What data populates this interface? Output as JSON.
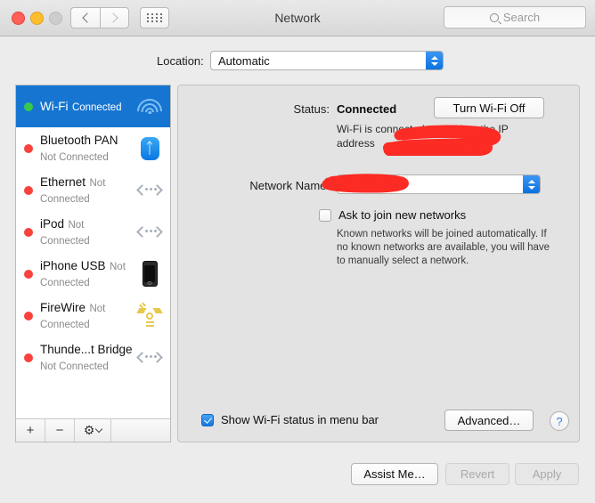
{
  "window": {
    "title": "Network",
    "traffic_lights": [
      "close",
      "minimize",
      "zoom"
    ],
    "search_placeholder": "Search",
    "nav_back": "‹",
    "nav_forward": "›"
  },
  "location": {
    "label": "Location:",
    "value": "Automatic"
  },
  "sidebar": {
    "services": [
      {
        "name": "Wi-Fi",
        "status": "Connected",
        "dot": "green",
        "icon": "wifi-icon",
        "selected": true
      },
      {
        "name": "Bluetooth PAN",
        "status": "Not Connected",
        "dot": "red",
        "icon": "bluetooth-icon",
        "selected": false
      },
      {
        "name": "Ethernet",
        "status": "Not Connected",
        "dot": "red",
        "icon": "port-icon",
        "selected": false
      },
      {
        "name": "iPod",
        "status": "Not Connected",
        "dot": "red",
        "icon": "port-icon",
        "selected": false
      },
      {
        "name": "iPhone USB",
        "status": "Not Connected",
        "dot": "red",
        "icon": "iphone-icon",
        "selected": false
      },
      {
        "name": "FireWire",
        "status": "Not Connected",
        "dot": "red",
        "icon": "firewire-icon",
        "selected": false
      },
      {
        "name": "Thunde...t Bridge",
        "status": "Not Connected",
        "dot": "red",
        "icon": "port-icon",
        "selected": false
      }
    ],
    "footer": {
      "add": "+",
      "remove": "−",
      "gear": "⚙"
    }
  },
  "detail": {
    "status_label": "Status:",
    "status_value": "Connected",
    "turn_wifi_button": "Turn Wi-Fi Off",
    "status_description": "Wi-Fi is connected to  and has the IP address",
    "network_name_label": "Network Name:",
    "network_name_value": "",
    "ask_checkbox_label": "Ask to join new networks",
    "ask_checkbox_checked": false,
    "ask_description": "Known networks will be joined automatically. If no known networks are available, you will have to manually select a network.",
    "show_status_label": "Show Wi-Fi status in menu bar",
    "show_status_checked": true,
    "advanced_button": "Advanced…",
    "help_button": "?"
  },
  "bottom_bar": {
    "assist": "Assist Me…",
    "revert": "Revert",
    "apply": "Apply"
  },
  "colors": {
    "accent_blue": "#1675d1",
    "selected_row": "#1675d1",
    "connected_dot": "#36c94a",
    "disconnected_dot": "#f8433c",
    "redaction": "#fc2b24",
    "window_bg": "#ececec",
    "panel_bg": "#e3e3e3"
  }
}
